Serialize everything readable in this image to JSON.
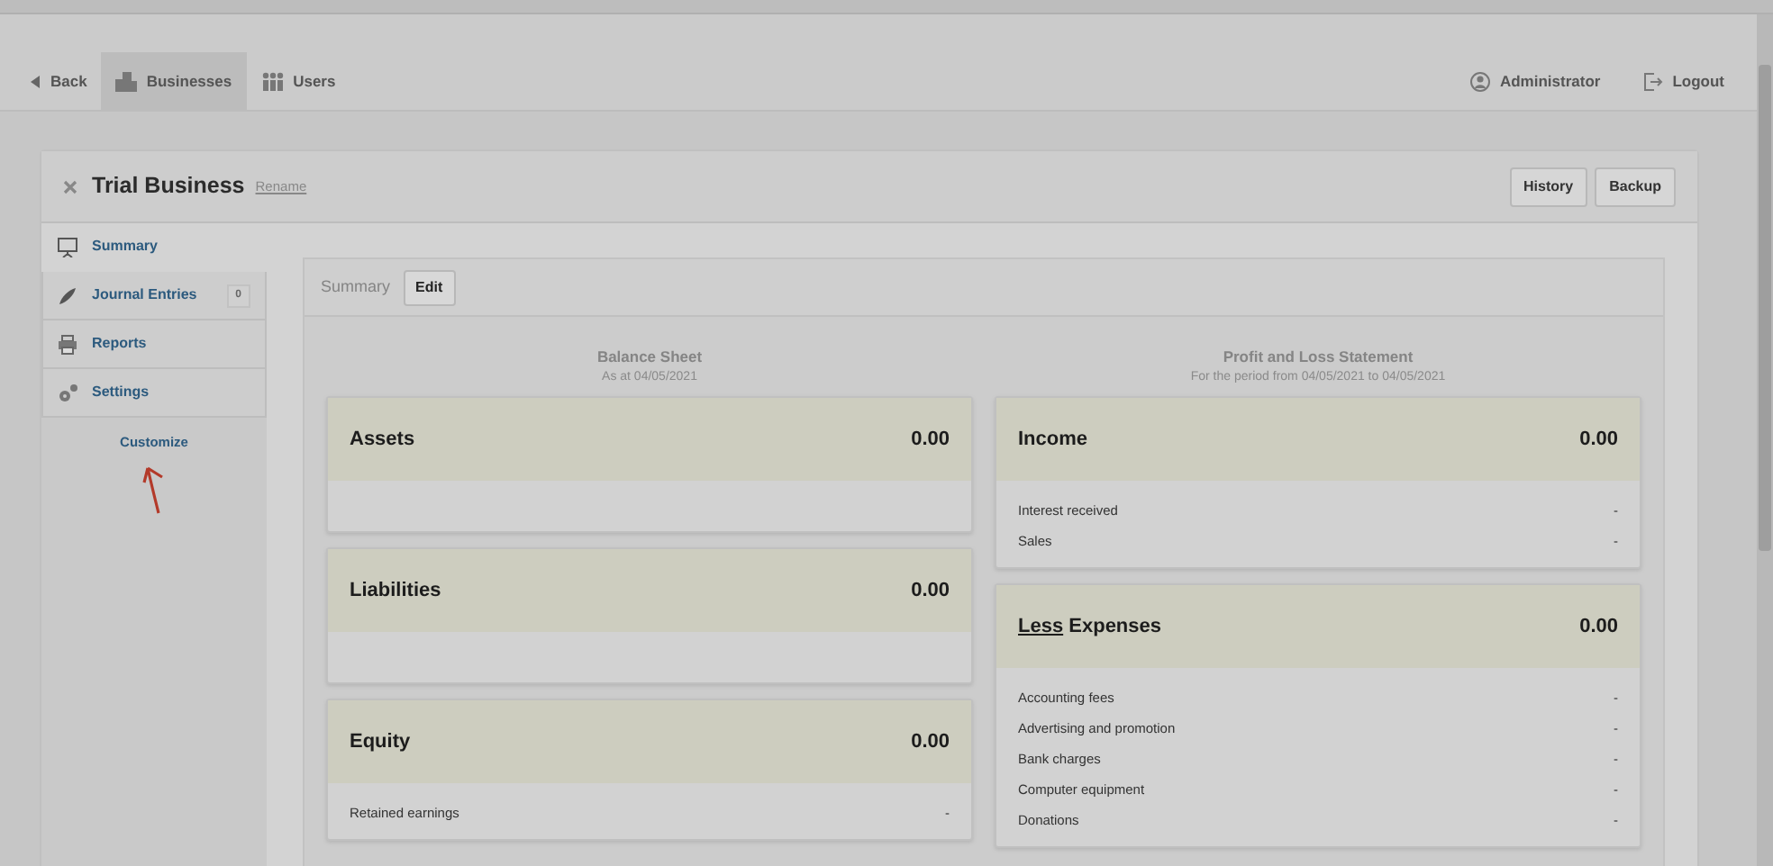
{
  "nav": {
    "left": [
      {
        "label": "Back",
        "selected": false
      },
      {
        "label": "Businesses",
        "selected": true
      },
      {
        "label": "Users",
        "selected": false
      }
    ],
    "right": [
      {
        "label": "Administrator"
      },
      {
        "label": "Logout"
      }
    ]
  },
  "business": {
    "title": "Trial Business",
    "rename": "Rename",
    "buttons": [
      "History",
      "Backup"
    ]
  },
  "sidebar": {
    "items": [
      {
        "label": "Summary",
        "selected": true
      },
      {
        "label": "Journal Entries",
        "selected": false,
        "count": "0"
      },
      {
        "label": "Reports",
        "selected": false
      },
      {
        "label": "Settings",
        "selected": false
      }
    ],
    "customize": "Customize"
  },
  "toolbar": {
    "title": "Summary",
    "button": "Edit"
  },
  "balance_sheet": {
    "title": "Balance Sheet",
    "subtitle": "As at 04/05/2021",
    "sections": [
      {
        "title": "Assets",
        "total": "0.00"
      },
      {
        "title": "Liabilities",
        "total": "0.00"
      },
      {
        "title": "Equity",
        "total": "0.00",
        "rows": [
          {
            "label": "Retained earnings",
            "value": "-"
          }
        ]
      }
    ]
  },
  "profit_loss": {
    "title": "Profit and Loss Statement",
    "subtitle": "For the period from 04/05/2021 to 04/05/2021",
    "sections": [
      {
        "title": "Income",
        "total": "0.00",
        "rows": [
          {
            "label": "Interest received",
            "value": "-"
          },
          {
            "label": "Sales",
            "value": "-"
          }
        ]
      },
      {
        "prefix": "Less",
        "title": "Expenses",
        "total": "0.00",
        "rows": [
          {
            "label": "Accounting fees",
            "value": "-"
          },
          {
            "label": "Advertising and promotion",
            "value": "-"
          },
          {
            "label": "Bank charges",
            "value": "-"
          },
          {
            "label": "Computer equipment",
            "value": "-"
          },
          {
            "label": "Donations",
            "value": "-"
          }
        ]
      }
    ]
  }
}
